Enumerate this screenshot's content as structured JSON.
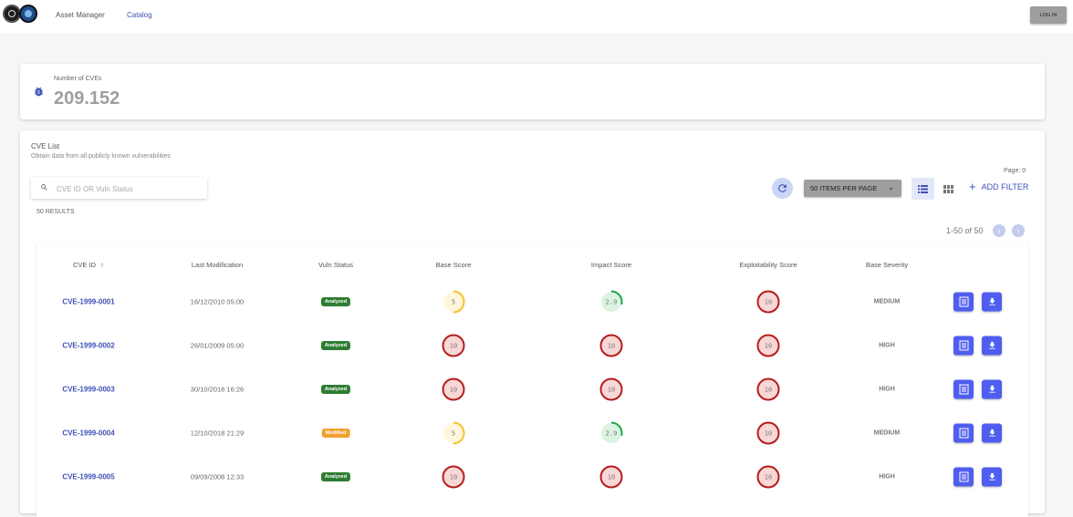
{
  "header": {
    "nav": [
      {
        "label": "Asset Manager",
        "active": false
      },
      {
        "label": "Catalog",
        "active": true
      }
    ],
    "login_label": "LOG IN"
  },
  "stats": {
    "label": "Number of CVEs",
    "value": "209.152",
    "icon": "bug-icon"
  },
  "list": {
    "title": "CVE List",
    "subtitle": "Obtain data from all publicly known vulnerabilities",
    "page_label": "Page: 0",
    "search_placeholder": "CVE ID OR Vuln Status",
    "results_label": "50 RESULTS",
    "per_page_label": "50 ITEMS PER PAGE",
    "add_filter_label": "ADD FILTER",
    "pager_info": "1-50 of 50"
  },
  "table": {
    "columns": [
      "CVE ID",
      "Last Modification",
      "Vuln Status",
      "Base Score",
      "Impact Score",
      "Exploitability Score",
      "Base Severity"
    ],
    "sort_column": "CVE ID",
    "sort_direction": "ascending",
    "rows": [
      {
        "cve_id": "CVE-1999-0001",
        "modified": "16/12/2010 05:00",
        "status": "Analyzed",
        "base": "5",
        "impact": "2.9",
        "exploit": "10",
        "severity": "MEDIUM"
      },
      {
        "cve_id": "CVE-1999-0002",
        "modified": "26/01/2009 05:00",
        "status": "Analyzed",
        "base": "10",
        "impact": "10",
        "exploit": "10",
        "severity": "HIGH"
      },
      {
        "cve_id": "CVE-1999-0003",
        "modified": "30/10/2018 16:26",
        "status": "Analyzed",
        "base": "10",
        "impact": "10",
        "exploit": "10",
        "severity": "HIGH"
      },
      {
        "cve_id": "CVE-1999-0004",
        "modified": "12/10/2018 21:29",
        "status": "Modified",
        "base": "5",
        "impact": "2.9",
        "exploit": "10",
        "severity": "MEDIUM"
      },
      {
        "cve_id": "CVE-1999-0005",
        "modified": "09/09/2008 12:33",
        "status": "Analyzed",
        "base": "10",
        "impact": "10",
        "exploit": "10",
        "severity": "HIGH"
      }
    ]
  },
  "colors": {
    "accent": "#3f51b5",
    "action": "#4f5ef0",
    "status_analyzed": "#2e7d32",
    "status_modified": "#f0a030",
    "score_high": "#b71c1c",
    "score_high_fill": "#f8d7d7",
    "score_medium": "#f5c12e",
    "score_medium_fill": "#fff6dc",
    "score_low": "#1fa84a",
    "score_low_fill": "#dcf3e2"
  }
}
